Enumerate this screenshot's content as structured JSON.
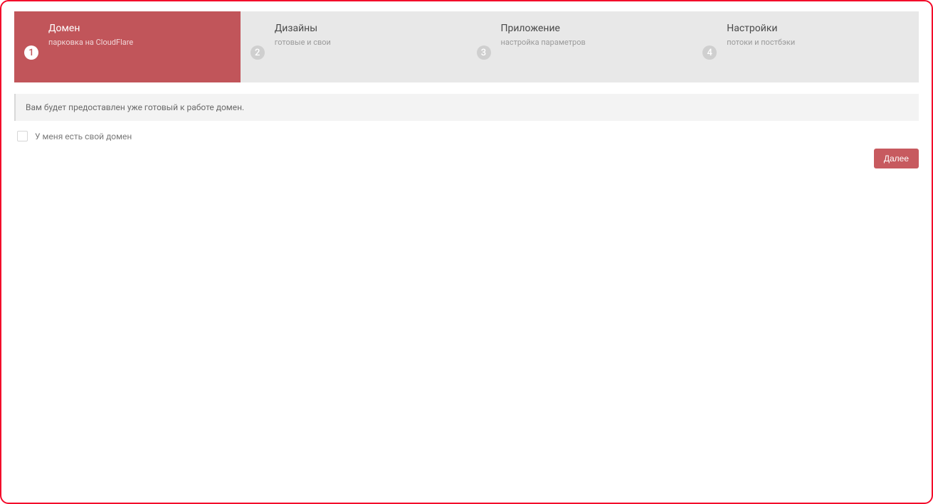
{
  "steps": [
    {
      "num": "1",
      "title": "Домен",
      "subtitle": "парковка на CloudFlare",
      "active": true
    },
    {
      "num": "2",
      "title": "Дизайны",
      "subtitle": "готовые и свои",
      "active": false
    },
    {
      "num": "3",
      "title": "Приложение",
      "subtitle": "настройка параметров",
      "active": false
    },
    {
      "num": "4",
      "title": "Настройки",
      "subtitle": "потоки и постбэки",
      "active": false
    }
  ],
  "info_text": "Вам будет предоставлен уже готовый к работе домен.",
  "checkbox_label": "У меня есть свой домен",
  "next_button": "Далее"
}
